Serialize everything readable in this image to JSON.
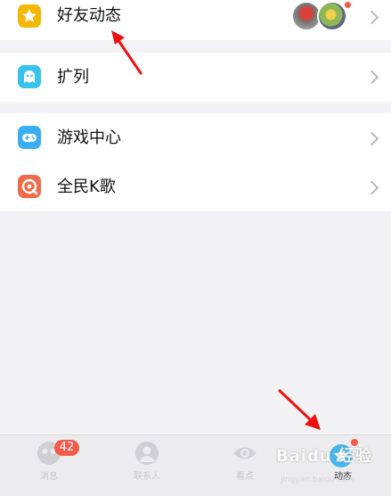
{
  "menu": {
    "friends_feed": {
      "label": "好友动态",
      "icon": "star-icon",
      "color": "#f5b800"
    },
    "expand": {
      "label": "扩列",
      "icon": "ghost-icon",
      "color": "#38c2ee"
    },
    "game_center": {
      "label": "游戏中心",
      "icon": "gamepad-icon",
      "color": "#3aaef2"
    },
    "karaoke": {
      "label": "全民K歌",
      "icon": "karaoke-icon",
      "color": "#f06b4a"
    }
  },
  "tabbar": {
    "messages": {
      "label": "消息",
      "badge": "42",
      "icon": "chat-icon"
    },
    "contacts": {
      "label": "联系人",
      "icon": "person-icon"
    },
    "watch": {
      "label": "看点",
      "icon": "eye-icon"
    },
    "feed": {
      "label": "动态",
      "icon": "star-bubble-icon"
    }
  },
  "watermark": {
    "brand": "Baidu 经验",
    "url": "jingyan.baidu.com"
  },
  "colors": {
    "badge": "#f25a4a",
    "annotation_arrow": "#ee1010",
    "notice_dot": "#f25a4a"
  }
}
